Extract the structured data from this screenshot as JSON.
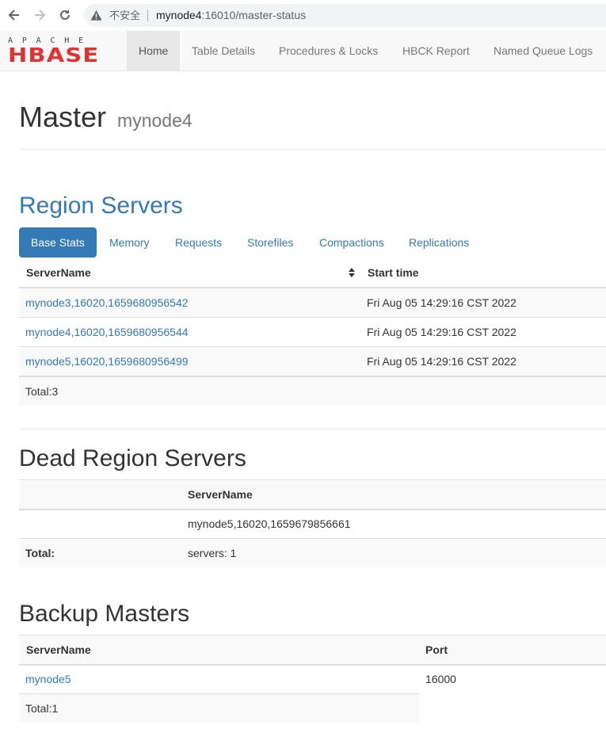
{
  "browser": {
    "insecure_label": "不安全",
    "url_host": "mynode4",
    "url_rest": ":16010/master-status"
  },
  "navbar": {
    "logo_top": "APACHE",
    "logo_main": "HBASE",
    "items": [
      {
        "label": "Home",
        "active": true
      },
      {
        "label": "Table Details"
      },
      {
        "label": "Procedures & Locks"
      },
      {
        "label": "HBCK Report"
      },
      {
        "label": "Named Queue Logs"
      }
    ]
  },
  "header": {
    "title": "Master",
    "subtitle": "mynode4"
  },
  "region_servers": {
    "heading": "Region Servers",
    "tabs": [
      "Base Stats",
      "Memory",
      "Requests",
      "Storefiles",
      "Compactions",
      "Replications"
    ],
    "columns": [
      "ServerName",
      "Start time"
    ],
    "rows": [
      {
        "server": "mynode3,16020,1659680956542",
        "start": "Fri Aug 05 14:29:16 CST 2022"
      },
      {
        "server": "mynode4,16020,1659680956544",
        "start": "Fri Aug 05 14:29:16 CST 2022"
      },
      {
        "server": "mynode5,16020,1659680956499",
        "start": "Fri Aug 05 14:29:16 CST 2022"
      }
    ],
    "total": "Total:3"
  },
  "dead_region_servers": {
    "heading": "Dead Region Servers",
    "column": "ServerName",
    "row": "mynode5,16020,1659679856661",
    "total_label": "Total:",
    "total_value": "servers: 1"
  },
  "backup_masters": {
    "heading": "Backup Masters",
    "columns": [
      "ServerName",
      "Port"
    ],
    "rows": [
      {
        "server": "mynode5",
        "port": "16000"
      }
    ],
    "total": "Total:1"
  },
  "colors": {
    "link": "#337ab7",
    "active_tab": "#337ab7",
    "logo_red": "#dd3333"
  }
}
